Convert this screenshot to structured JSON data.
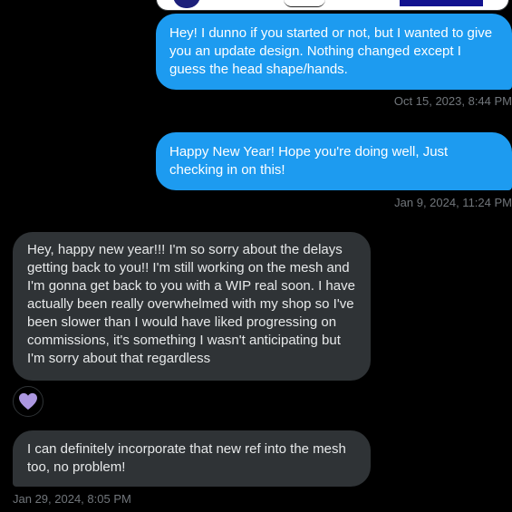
{
  "messages": [
    {
      "direction": "sent",
      "text": "Hey! I dunno if you started or not, but I wanted to give you an update design. Nothing changed except I guess the head shape/hands.",
      "timestamp": "Oct 15, 2023, 8:44 PM"
    },
    {
      "direction": "sent",
      "text": "Happy New Year!  Hope you're doing well, Just checking in on this!",
      "timestamp": "Jan 9, 2024, 11:24 PM"
    },
    {
      "direction": "received",
      "text": "Hey, happy new year!!! I'm so sorry about the delays getting back to you!! I'm still working on the mesh and I'm gonna get back to you with a WIP real soon. I have actually been really overwhelmed with my shop so I've been slower than I would have liked progressing on commissions, it's something I wasn't anticipating but I'm sorry about that regardless",
      "reaction": "purple-heart"
    },
    {
      "direction": "received",
      "text": "I can definitely incorporate that new ref into the mesh too, no problem!",
      "timestamp": "Jan 29, 2024, 8:05 PM"
    }
  ],
  "colors": {
    "background": "#000000",
    "sent_bubble": "#1d9bf0",
    "received_bubble": "#2f3336",
    "timestamp": "#71767b",
    "reaction_heart": "#ac97e0"
  }
}
